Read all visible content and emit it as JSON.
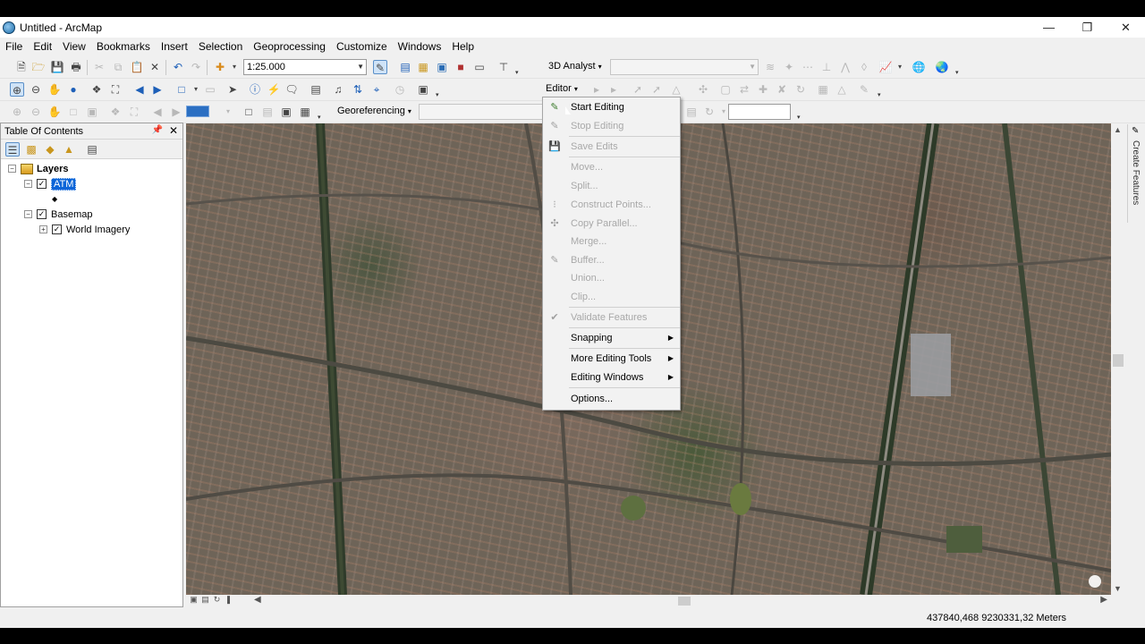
{
  "window": {
    "title": "Untitled - ArcMap",
    "controls": [
      "minimize",
      "restore",
      "close"
    ]
  },
  "menubar": [
    "File",
    "Edit",
    "View",
    "Bookmarks",
    "Insert",
    "Selection",
    "Geoprocessing",
    "Customize",
    "Windows",
    "Help"
  ],
  "toolbar": {
    "scale_value": "1:25.000",
    "analyst_label": "3D Analyst",
    "analyst_layer_value": "",
    "editor_label": "Editor",
    "georeferencing_label": "Georeferencing",
    "georef_layer_value": "",
    "angle_value": ""
  },
  "toc": {
    "title": "Table Of Contents",
    "layers_label": "Layers",
    "atm_label": "ATM",
    "atm_symbol": "◆",
    "basemap_label": "Basemap",
    "world_imagery_label": "World Imagery"
  },
  "editor_menu": {
    "start_editing": "Start Editing",
    "stop_editing": "Stop Editing",
    "save_edits": "Save Edits",
    "move": "Move...",
    "split": "Split...",
    "construct_points": "Construct Points...",
    "copy_parallel": "Copy Parallel...",
    "merge": "Merge...",
    "buffer": "Buffer...",
    "union": "Union...",
    "clip": "Clip...",
    "validate_features": "Validate Features",
    "snapping": "Snapping",
    "more_editing_tools": "More Editing Tools",
    "editing_windows": "Editing Windows",
    "options": "Options..."
  },
  "right_panel": {
    "create_features_label": "Create Features"
  },
  "status": {
    "coordinates": "437840,468  9230331,32 Meters"
  },
  "colors": {
    "selection_blue": "#0a64d8",
    "disabled_text": "#a8a8a8",
    "map_base": "#6e6458"
  }
}
